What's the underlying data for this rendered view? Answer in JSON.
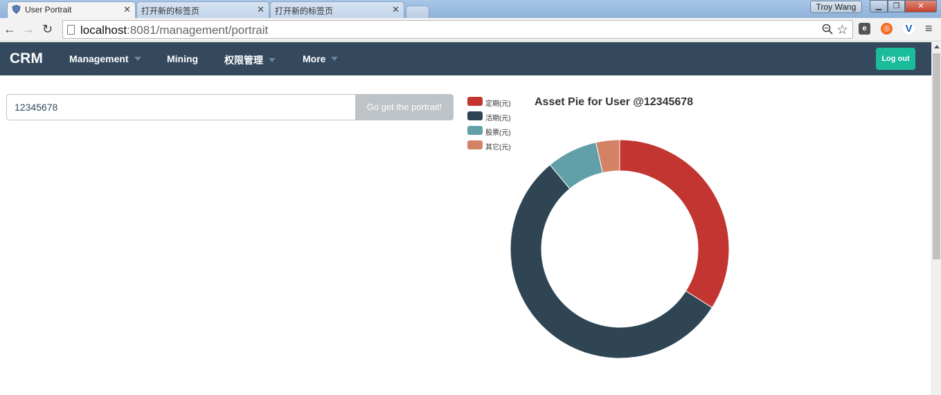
{
  "browser": {
    "tabs": [
      {
        "title": "User Portrait",
        "active": true
      },
      {
        "title": "打开新的标签页",
        "active": false
      },
      {
        "title": "打开新的标签页",
        "active": false
      }
    ],
    "user": "Troy Wang",
    "url_host": "localhost",
    "url_path": ":8081/management/portrait"
  },
  "navbar": {
    "brand": "CRM",
    "items": [
      {
        "label": "Management",
        "dropdown": true
      },
      {
        "label": "Mining",
        "dropdown": false
      },
      {
        "label": "权限管理",
        "dropdown": true
      },
      {
        "label": "More",
        "dropdown": true
      }
    ],
    "logout": "Log out"
  },
  "search": {
    "value": "12345678",
    "button": "Go get the portrait!"
  },
  "chart_data": {
    "type": "pie",
    "donut": true,
    "title": "Asset Pie for User @12345678",
    "legend_position": "top-left",
    "series": [
      {
        "name": "定期(元)",
        "value": 34,
        "color": "#c23531"
      },
      {
        "name": "活期(元)",
        "value": 55,
        "color": "#2f4554"
      },
      {
        "name": "股票(元)",
        "value": 7.5,
        "color": "#61a0a8"
      },
      {
        "name": "其它(元)",
        "value": 3.5,
        "color": "#d48265"
      }
    ]
  }
}
